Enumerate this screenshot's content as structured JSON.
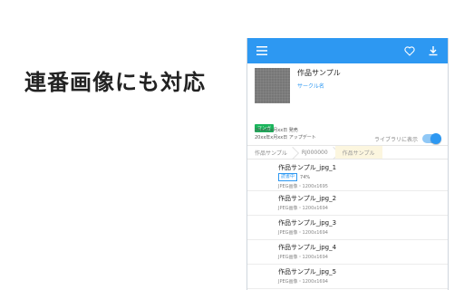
{
  "promo": {
    "headline": "連番画像にも対応"
  },
  "appbar": {
    "menu_icon": "menu-icon",
    "favorite_icon": "heart-icon",
    "download_icon": "download-icon",
    "color": "#2d98f2"
  },
  "work": {
    "title": "作品サンプル",
    "circle": "サークル名",
    "badge": "マンガ",
    "release": "20xx年x月xx日 発売",
    "update": "20xx年x月xx日 アップデート",
    "library_label": "ライブラリに表示",
    "library_on": true
  },
  "breadcrumbs": [
    "作品サンプル",
    "RJ000000",
    "作品サンプル"
  ],
  "files": [
    {
      "name": "作品サンプル_jpg_1",
      "status": "読書中",
      "progress": "74%",
      "info": "JPEG画像・1200x1695"
    },
    {
      "name": "作品サンプル_jpg_2",
      "info": "JPEG画像・1200x1694"
    },
    {
      "name": "作品サンプル_jpg_3",
      "info": "JPEG画像・1200x1694"
    },
    {
      "name": "作品サンプル_jpg_4",
      "info": "JPEG画像・1200x1694"
    },
    {
      "name": "作品サンプル_jpg_5",
      "info": "JPEG画像・1200x1694"
    }
  ]
}
